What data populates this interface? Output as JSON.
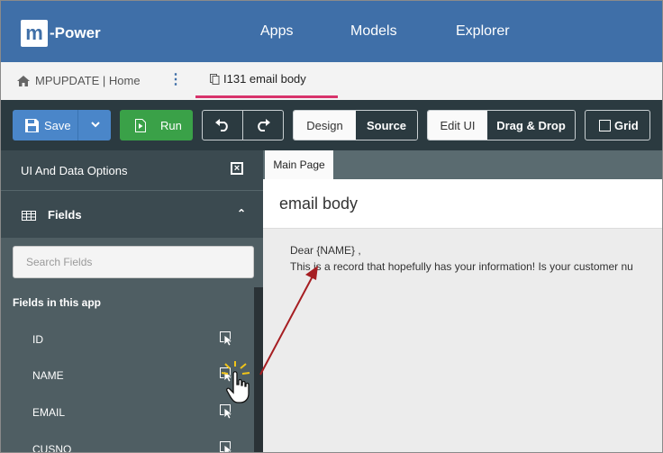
{
  "app": {
    "logo_letter": "m",
    "logo_text": "-Power"
  },
  "nav": {
    "items": [
      "Apps",
      "Models",
      "Explorer"
    ]
  },
  "tabs": {
    "home_label": "MPUPDATE | Home",
    "doc_tab_label": "I131 email body"
  },
  "toolbar": {
    "save_label": "Save",
    "run_label": "Run",
    "design_label": "Design",
    "source_label": "Source",
    "editui_label": "Edit UI",
    "dragdrop_label": "Drag & Drop",
    "grid_label": "Grid"
  },
  "panel": {
    "title": "UI And Data Options",
    "fields_header": "Fields",
    "search_placeholder": "Search Fields",
    "section_label": "Fields in this app",
    "fields": [
      "ID",
      "NAME",
      "EMAIL",
      "CUSNO"
    ]
  },
  "canvas": {
    "tab_label": "Main Page",
    "title": "email body",
    "line1": "Dear {NAME} ,",
    "line2": "This is a record that hopefully has your information! Is your customer nu"
  },
  "colors": {
    "topbar": "#3f6fa8",
    "toolbar": "#2b3a40",
    "save": "#4a86c9",
    "run": "#3aa148",
    "active_tab": "#d8336b",
    "arrow": "#a61e22"
  }
}
